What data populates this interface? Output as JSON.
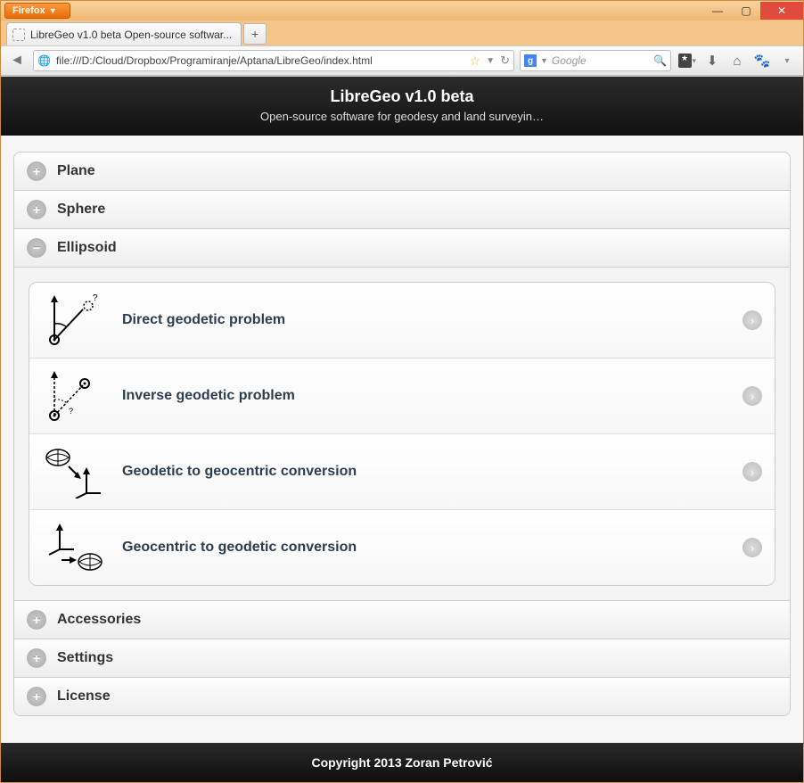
{
  "window": {
    "firefox_label": "Firefox",
    "tab_title": "LibreGeo v1.0 beta Open-source softwar...",
    "url": "file:///D:/Cloud/Dropbox/Programiranje/Aptana/LibreGeo/index.html",
    "search_placeholder": "Google"
  },
  "header": {
    "title": "LibreGeo v1.0 beta",
    "subtitle": "Open-source software for geodesy and land surveyin…"
  },
  "accordion": [
    {
      "label": "Plane",
      "expanded": false
    },
    {
      "label": "Sphere",
      "expanded": false
    },
    {
      "label": "Ellipsoid",
      "expanded": true
    },
    {
      "label": "Accessories",
      "expanded": false
    },
    {
      "label": "Settings",
      "expanded": false
    },
    {
      "label": "License",
      "expanded": false
    }
  ],
  "ellipsoid_items": [
    {
      "label": "Direct geodetic problem",
      "icon": "direct-problem"
    },
    {
      "label": "Inverse geodetic problem",
      "icon": "inverse-problem"
    },
    {
      "label": "Geodetic to geocentric conversion",
      "icon": "geo-to-geocentric"
    },
    {
      "label": "Geocentric to geodetic conversion",
      "icon": "geocentric-to-geo"
    }
  ],
  "footer": "Copyright 2013 Zoran Petrović"
}
